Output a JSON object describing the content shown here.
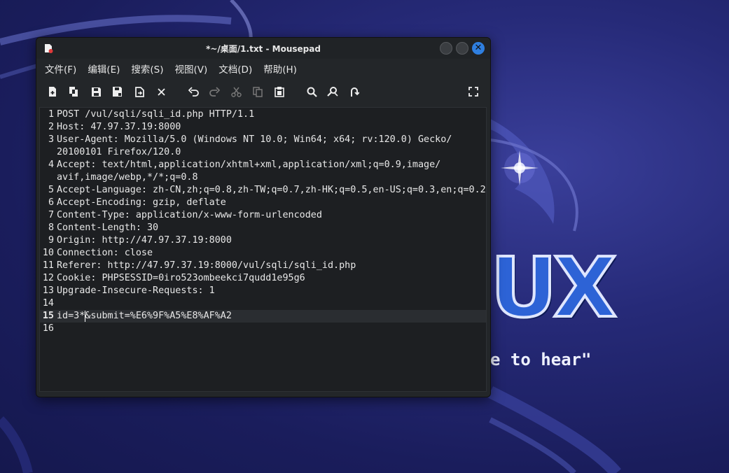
{
  "window": {
    "title": "*~/桌面/1.txt - Mousepad"
  },
  "menu": [
    "文件(F)",
    "编辑(E)",
    "搜索(S)",
    "视图(V)",
    "文档(D)",
    "帮助(H)"
  ],
  "toolbar_icons": [
    "new-document-icon",
    "new-window-icon",
    "save-icon",
    "save-as-icon",
    "reload-icon",
    "close-document-icon",
    "undo-icon",
    "redo-icon",
    "cut-icon",
    "copy-icon",
    "paste-icon",
    "find-icon",
    "find-replace-icon",
    "go-to-icon",
    "fullscreen-icon"
  ],
  "editor": {
    "current_line": 15,
    "lines": [
      {
        "no": "1",
        "text": "POST /vul/sqli/sqli_id.php HTTP/1.1"
      },
      {
        "no": "2",
        "text": "Host: 47.97.37.19:8000"
      },
      {
        "no": "3",
        "text": "User-Agent: Mozilla/5.0 (Windows NT 10.0; Win64; x64; rv:120.0) Gecko/"
      },
      {
        "no": "",
        "text": "20100101 Firefox/120.0"
      },
      {
        "no": "4",
        "text": "Accept: text/html,application/xhtml+xml,application/xml;q=0.9,image/"
      },
      {
        "no": "",
        "text": "avif,image/webp,*/*;q=0.8"
      },
      {
        "no": "5",
        "text": "Accept-Language: zh-CN,zh;q=0.8,zh-TW;q=0.7,zh-HK;q=0.5,en-US;q=0.3,en;q=0.2"
      },
      {
        "no": "6",
        "text": "Accept-Encoding: gzip, deflate"
      },
      {
        "no": "7",
        "text": "Content-Type: application/x-www-form-urlencoded"
      },
      {
        "no": "8",
        "text": "Content-Length: 30"
      },
      {
        "no": "9",
        "text": "Origin: http://47.97.37.19:8000"
      },
      {
        "no": "10",
        "text": "Connection: close"
      },
      {
        "no": "11",
        "text": "Referer: http://47.97.37.19:8000/vul/sqli/sqli_id.php"
      },
      {
        "no": "12",
        "text": "Cookie: PHPSESSID=0iro523ombeekci7qudd1e95g6"
      },
      {
        "no": "13",
        "text": "Upgrade-Insecure-Requests: 1"
      },
      {
        "no": "14",
        "text": ""
      },
      {
        "no": "15",
        "text": "id=3*&submit=%E6%9F%A5%E8%AF%A2"
      },
      {
        "no": "16",
        "text": ""
      }
    ]
  },
  "wallpaper": {
    "logo_text": "UX",
    "tagline": "e to hear\""
  },
  "colors": {
    "accent": "#2f7fe0",
    "wallpaper": "#262a78",
    "editor_bg": "#1d1f22"
  }
}
